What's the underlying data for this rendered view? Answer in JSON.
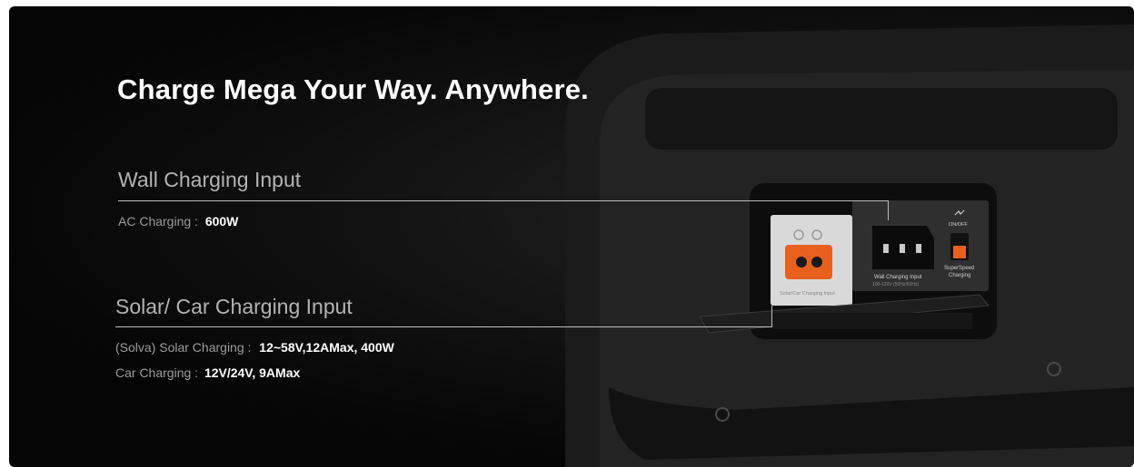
{
  "title": "Charge Mega Your Way. Anywhere.",
  "wall": {
    "heading": "Wall Charging Input",
    "ac_label": "AC Charging :",
    "ac_value": "600W"
  },
  "solar": {
    "heading": "Solar/ Car Charging Input",
    "solar_label": "(Solva) Solar Charging :",
    "solar_value": "12~58V,12AMax, 400W",
    "car_label": "Car Charging :",
    "car_value": "12V/24V, 9AMax"
  },
  "device": {
    "solar_port_label": "Solar/Car Charging Input",
    "wall_port_label": "Wall Charging Input",
    "wall_port_spec": "100-120V (50Hz/60Hz)",
    "switch_label": "ON/OFF",
    "superspeed_label_1": "SuperSpeed",
    "superspeed_label_2": "Charging"
  },
  "colors": {
    "port_orange": "#e8601e",
    "text_white": "#ffffff",
    "text_grey": "#9c9c9c"
  }
}
